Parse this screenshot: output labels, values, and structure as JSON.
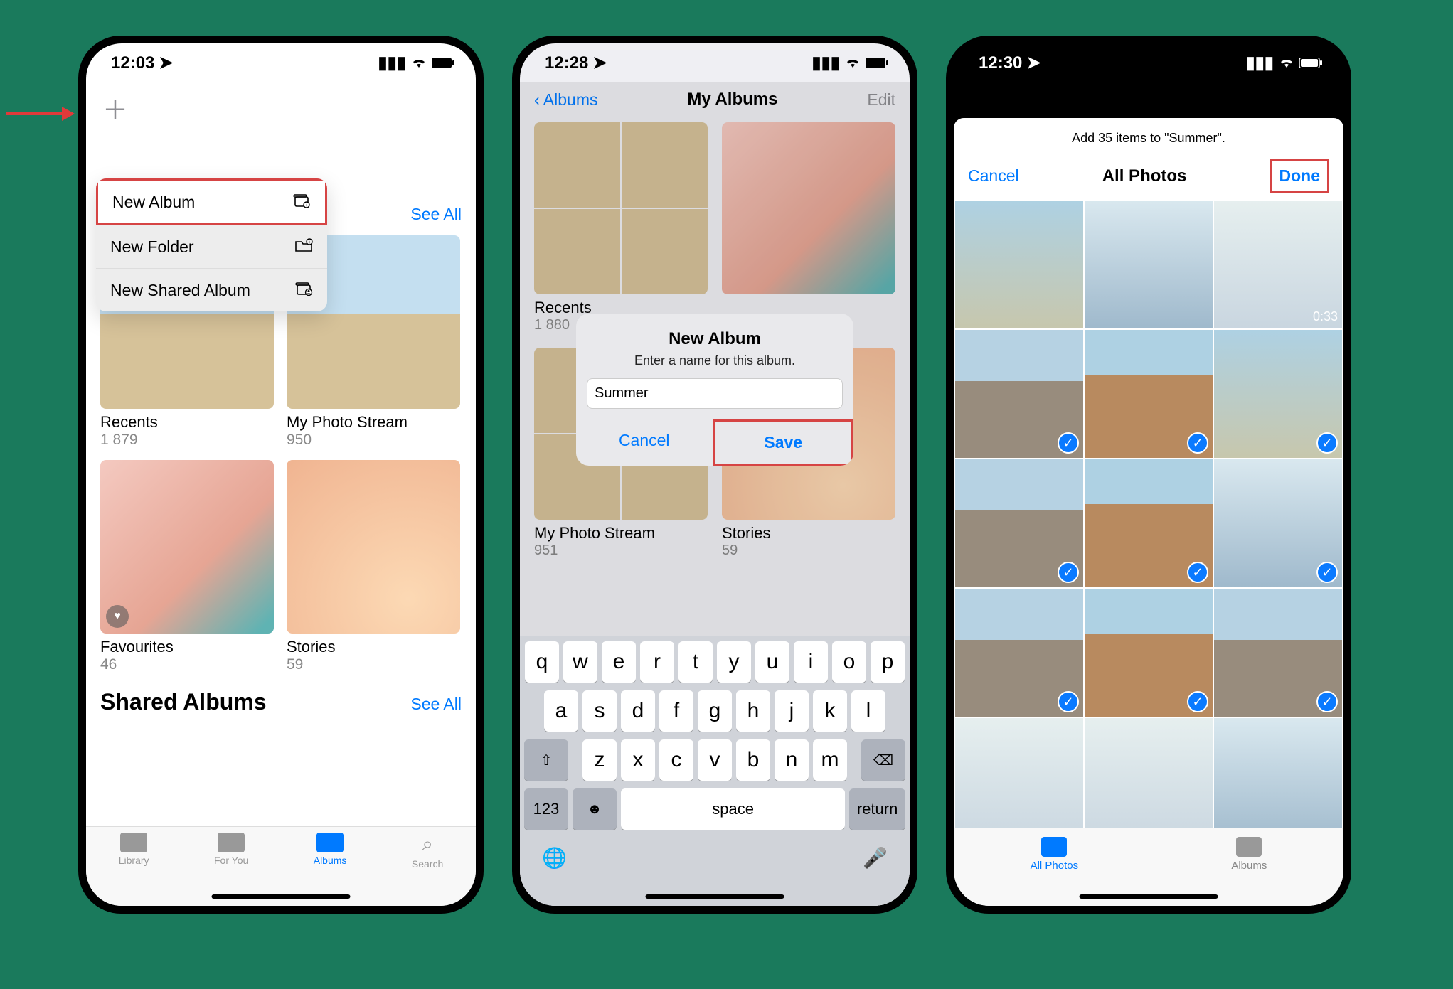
{
  "phones": {
    "p1": {
      "time": "12:03",
      "plus": "＋",
      "menu": {
        "new_album": "New Album",
        "new_folder": "New Folder",
        "new_shared": "New Shared Album"
      },
      "see_all": "See All",
      "albums": {
        "recents": {
          "name": "Recents",
          "count": "1 879"
        },
        "stream": {
          "name": "My Photo Stream",
          "count": "950"
        },
        "fav": {
          "name": "Favourites",
          "count": "46"
        },
        "stories": {
          "name": "Stories",
          "count": "59"
        }
      },
      "shared_h": "Shared Albums",
      "tabs": {
        "library": "Library",
        "for_you": "For You",
        "albums": "Albums",
        "search": "Search"
      }
    },
    "p2": {
      "time": "12:28",
      "back": "Albums",
      "title": "My Albums",
      "edit": "Edit",
      "cards": {
        "recents": {
          "name": "Recents",
          "count": "1 880"
        },
        "stream": {
          "name": "My Photo Stream",
          "count": "951"
        },
        "stories": {
          "name": "Stories",
          "count": "59"
        }
      },
      "alert": {
        "title": "New Album",
        "subtitle": "Enter a name for this album.",
        "value": "Summer",
        "cancel": "Cancel",
        "save": "Save"
      },
      "keyboard": {
        "r1": [
          "q",
          "w",
          "e",
          "r",
          "t",
          "y",
          "u",
          "i",
          "o",
          "p"
        ],
        "r2": [
          "a",
          "s",
          "d",
          "f",
          "g",
          "h",
          "j",
          "k",
          "l"
        ],
        "r3": [
          "z",
          "x",
          "c",
          "v",
          "b",
          "n",
          "m"
        ],
        "shift": "⇧",
        "bksp": "⌫",
        "num": "123",
        "emoji": "☻",
        "space": "space",
        "return": "return",
        "globe": "🌐",
        "mic": "🎤"
      }
    },
    "p3": {
      "time": "12:30",
      "msg": "Add 35 items to \"Summer\".",
      "cancel": "Cancel",
      "title": "All Photos",
      "done": "Done",
      "video_dur": "0:33",
      "tabs": {
        "all": "All Photos",
        "albums": "Albums"
      }
    }
  },
  "check_glyph": "✓"
}
